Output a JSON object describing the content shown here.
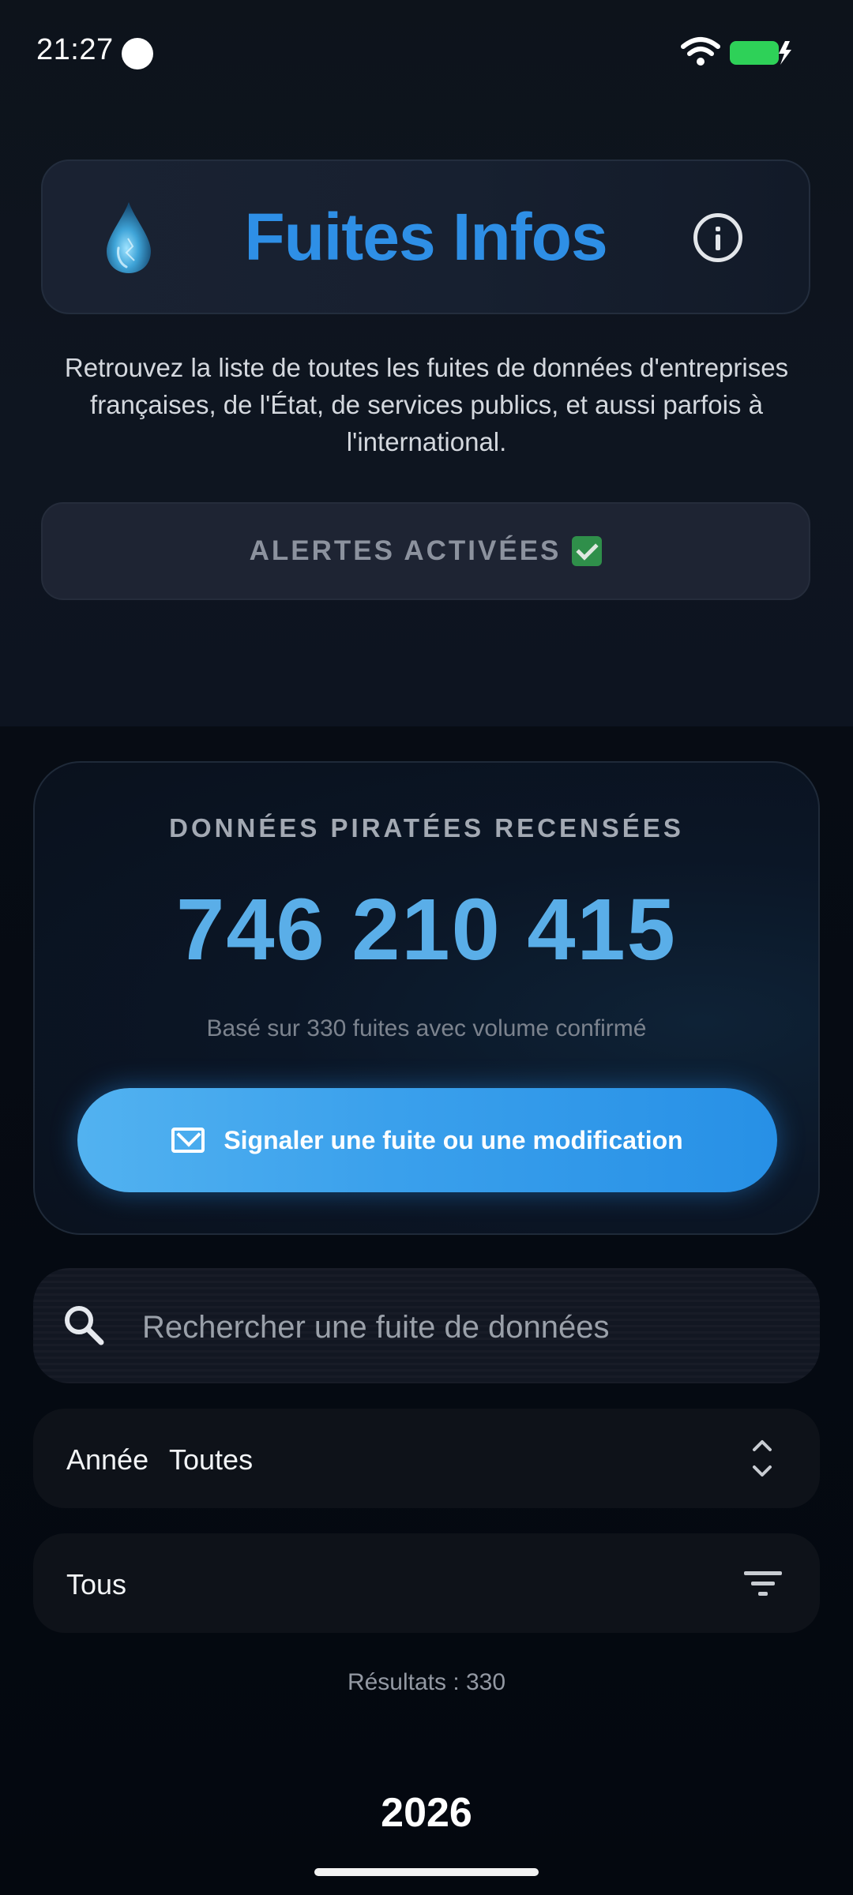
{
  "status_bar": {
    "time": "21:27"
  },
  "header": {
    "title": "Fuites Infos",
    "icon": "water-drop-icon",
    "info_icon": "info-icon"
  },
  "intro": {
    "text": "Retrouvez la liste de toutes les fuites de données d'entreprises françaises, de l'État, de services publics, et aussi parfois à l'international."
  },
  "alerts": {
    "label": "ALERTES ACTIVÉES"
  },
  "stats": {
    "label": "DONNÉES PIRATÉES RECENSÉES",
    "value": "746 210 415",
    "note": "Basé sur 330 fuites avec volume confirmé",
    "report_label": "Signaler une fuite ou une modification"
  },
  "search": {
    "placeholder": "Rechercher une fuite de données"
  },
  "filters": {
    "year_label": "Année",
    "year_value": "Toutes",
    "type_value": "Tous"
  },
  "results": {
    "text": "Résultats : 330"
  },
  "list": {
    "year_heading": "2026"
  },
  "colors": {
    "accent": "#2e8fe6",
    "stat_value": "#5aaee8",
    "background": "#0b1018"
  }
}
